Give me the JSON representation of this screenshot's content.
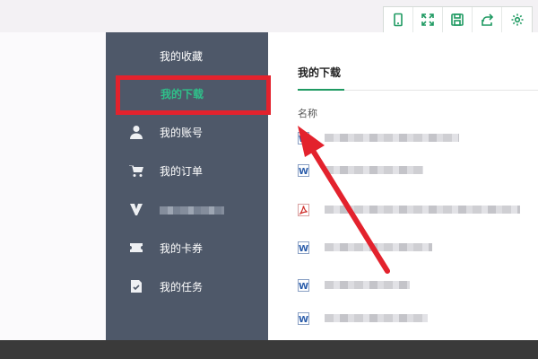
{
  "toolbar": {
    "buttons": [
      {
        "name": "phone-icon"
      },
      {
        "name": "fullscreen-icon"
      },
      {
        "name": "save-icon"
      },
      {
        "name": "share-icon"
      },
      {
        "name": "settings-icon"
      }
    ],
    "accent": "#1f9a62"
  },
  "sidebar": {
    "background": "#4e5869",
    "items": [
      {
        "label": "我的收藏",
        "icon": "none"
      },
      {
        "label": "我的下载",
        "icon": "none",
        "active": true
      },
      {
        "label": "我的账号",
        "icon": "user-icon"
      },
      {
        "label": "我的订单",
        "icon": "cart-icon"
      },
      {
        "label": "",
        "icon": "vip-icon",
        "blurred": true
      },
      {
        "label": "我的卡券",
        "icon": "ticket-icon"
      },
      {
        "label": "我的任务",
        "icon": "task-icon"
      }
    ],
    "active_color": "#2fc08a"
  },
  "panel": {
    "tab": "我的下载",
    "column_header": "名称",
    "files": [
      {
        "type": "word-icon"
      },
      {
        "type": "word-icon"
      },
      {
        "type": "pdf-icon"
      },
      {
        "type": "word-icon"
      },
      {
        "type": "word-icon"
      },
      {
        "type": "word-icon"
      }
    ]
  },
  "annotation": {
    "color": "#e3222d"
  }
}
